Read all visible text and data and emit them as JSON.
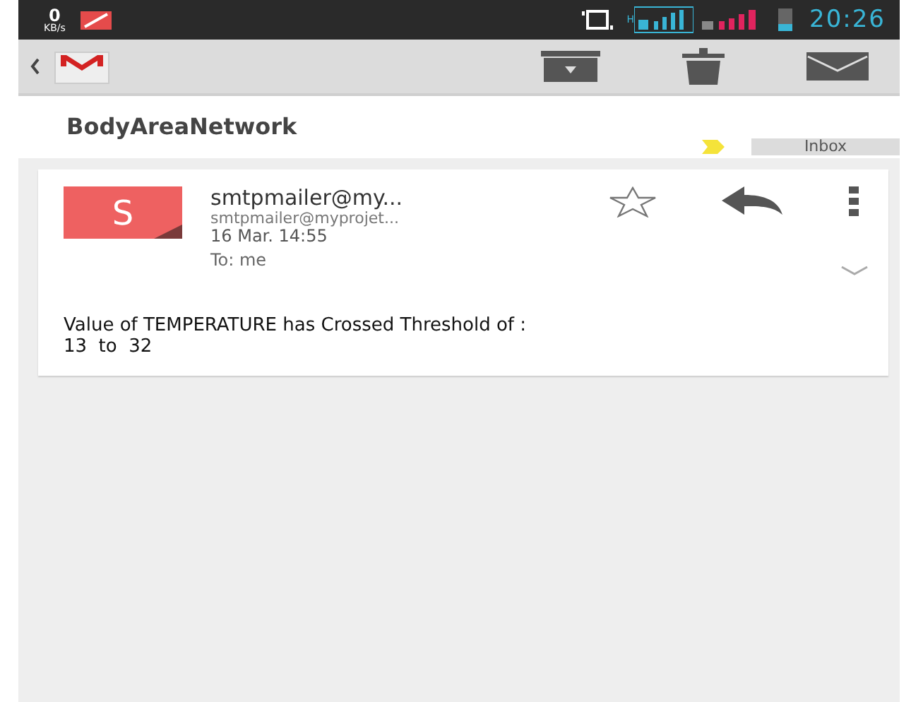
{
  "status_bar": {
    "speed_value": "0",
    "speed_unit": "KB/s",
    "network_type": "H",
    "time": "20:26"
  },
  "conversation": {
    "subject": "BodyAreaNetwork",
    "label": "Inbox"
  },
  "message": {
    "avatar_letter": "S",
    "sender": "smtpmailer@my...",
    "sender_address": "smtpmailer@myprojet...",
    "date": "16 Mar. 14:55",
    "recipient": "To: me",
    "starred": false,
    "body": [
      "Value of TEMPERATURE has Crossed Threshold of :",
      "13  to  32"
    ]
  }
}
